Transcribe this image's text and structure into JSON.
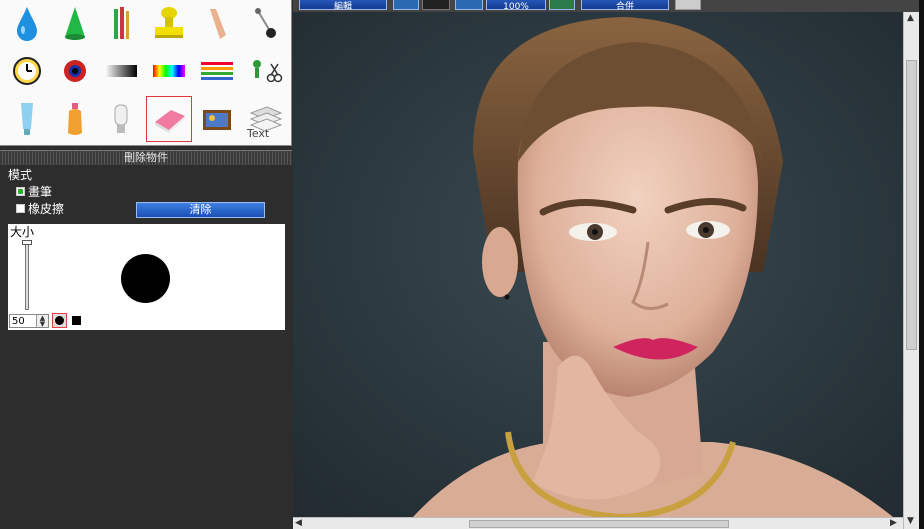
{
  "toolbar": {
    "btn1": "編輯",
    "zoom": "100%",
    "btn2": "合併"
  },
  "panel": {
    "title": "刪除物件",
    "mode_label": "模式",
    "options": [
      {
        "label": "畫筆",
        "checked": true
      },
      {
        "label": "橡皮擦",
        "checked": false
      }
    ],
    "clear_button": "清除",
    "size_label": "大小",
    "size_value": "50"
  },
  "tools": {
    "text_icon_label": "Text"
  },
  "colors": {
    "accent": "#2a5fc8",
    "selection": "#e03a3a",
    "lip": "#d0245f",
    "bg_canvas": "#2f3d44"
  },
  "icons": [
    "water-drop-icon",
    "cone-icon",
    "brushes-icon",
    "stamp-icon",
    "finger-icon",
    "pin-icon",
    "clock-icon",
    "eye-icon",
    "gradient-icon",
    "rainbow-icon",
    "lines-icon",
    "scissors-icon",
    "tube-icon",
    "bottle-icon",
    "lamp-icon",
    "eraser-icon",
    "photo-box-icon",
    "text-stack-icon"
  ]
}
